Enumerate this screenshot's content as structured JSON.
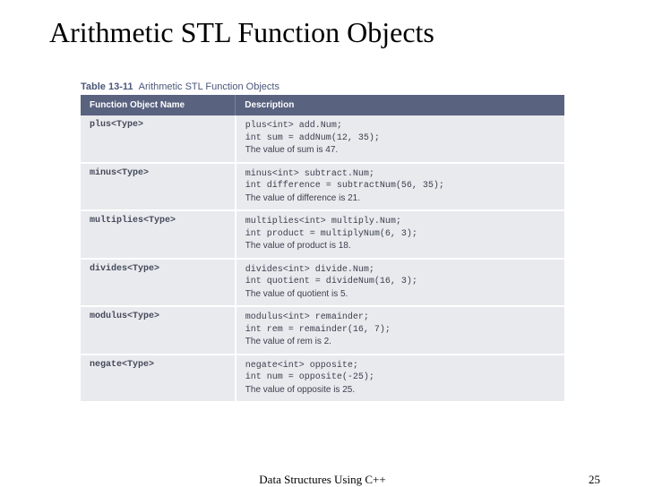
{
  "title": "Arithmetic STL Function Objects",
  "table": {
    "number": "Table 13-11",
    "caption": "Arithmetic STL Function Objects",
    "headers": {
      "c0": "Function Object Name",
      "c1": "Description"
    },
    "rows": [
      {
        "name": "plus<Type>",
        "code1": "plus<int> add.Num;",
        "code2": "int sum = addNum(12, 35);",
        "plain": "The value of sum is 47."
      },
      {
        "name": "minus<Type>",
        "code1": "minus<int> subtract.Num;",
        "code2": "int difference = subtractNum(56, 35);",
        "plain": "The value of difference is 21."
      },
      {
        "name": "multiplies<Type>",
        "code1": "multiplies<int> multiply.Num;",
        "code2": "int product = multiplyNum(6, 3);",
        "plain": "The value of product is 18."
      },
      {
        "name": "divides<Type>",
        "code1": "divides<int> divide.Num;",
        "code2": "int quotient = divideNum(16, 3);",
        "plain": "The value of quotient is 5."
      },
      {
        "name": "modulus<Type>",
        "code1": "modulus<int> remainder;",
        "code2": "int rem = remainder(16, 7);",
        "plain": "The value of rem is 2."
      },
      {
        "name": "negate<Type>",
        "code1": "negate<int> opposite;",
        "code2": "int num = opposite(-25);",
        "plain": "The value of opposite is 25."
      }
    ]
  },
  "footer": {
    "center": "Data Structures Using C++",
    "page": "25"
  }
}
